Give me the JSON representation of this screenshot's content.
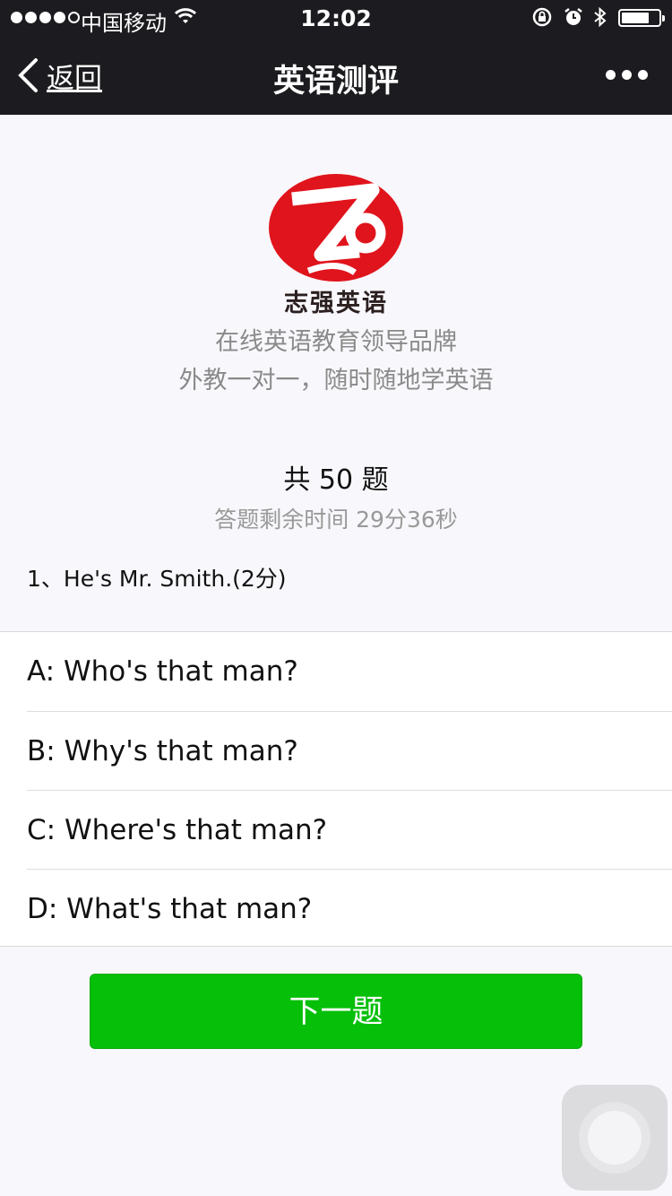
{
  "status_bar": {
    "carrier": "中国移动",
    "time": "12:02",
    "signal_bars_filled": 4,
    "signal_bars_total": 5,
    "battery_level": 0.75,
    "icons": [
      "wifi-icon",
      "orientation-lock-icon",
      "alarm-icon",
      "bluetooth-icon",
      "battery-icon"
    ]
  },
  "nav": {
    "back_label": "返回",
    "title": "英语测评",
    "more_icon": "more-dots-icon"
  },
  "brand": {
    "name": "志强英语",
    "tagline_1": "在线英语教育领导品牌",
    "tagline_2": "外教一对一，随时随地学英语"
  },
  "quiz": {
    "total": "共 50 题",
    "remaining": "答题剩余时间 29分36秒",
    "question": "1、He's Mr. Smith.(2分)",
    "options": [
      {
        "label": "A: Who's that man?"
      },
      {
        "label": "B: Why's that man?"
      },
      {
        "label": "C: Where's that man?"
      },
      {
        "label": "D: What's that man?"
      }
    ],
    "next_label": "下一题"
  },
  "colors": {
    "nav_bg": "#1c1c20",
    "logo_red": "#e0141c",
    "button_green": "#05bf09"
  }
}
